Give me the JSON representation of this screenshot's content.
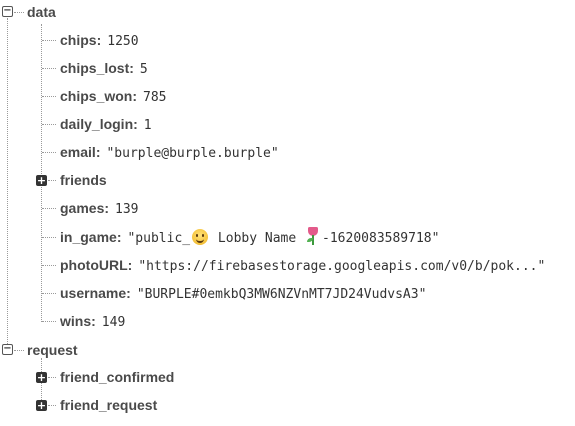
{
  "tree": {
    "data": {
      "label": "data",
      "children": {
        "chips": {
          "key": "chips",
          "value": "1250"
        },
        "chips_lost": {
          "key": "chips_lost",
          "value": "5"
        },
        "chips_won": {
          "key": "chips_won",
          "value": "785"
        },
        "daily_login": {
          "key": "daily_login",
          "value": "1"
        },
        "email": {
          "key": "email",
          "value": "\"burple@burple.burple\""
        },
        "friends": {
          "key": "friends",
          "expandable": true,
          "state": "collapsed"
        },
        "games": {
          "key": "games",
          "value": "139"
        },
        "in_game": {
          "key": "in_game",
          "value_prefix": "\"public_",
          "value_middle": " Lobby Name ",
          "value_suffix": "-1620083589718\"",
          "icons": [
            "smiling-face-emoji",
            "tulip-emoji"
          ]
        },
        "photoURL": {
          "key": "photoURL",
          "value": "\"https://firebasestorage.googleapis.com/v0/b/pok...\""
        },
        "username": {
          "key": "username",
          "value": "\"BURPLE#0emkbQ3MW6NZVnMT7JD24VudvsA3\""
        },
        "wins": {
          "key": "wins",
          "value": "149"
        }
      }
    },
    "request": {
      "label": "request",
      "children": {
        "friend_confirmed": {
          "key": "friend_confirmed",
          "expandable": true,
          "state": "collapsed"
        },
        "friend_request": {
          "key": "friend_request",
          "expandable": true,
          "state": "collapsed"
        }
      }
    }
  },
  "symbols": {
    "expanded": "−",
    "collapsed": "+",
    "colon": ":"
  }
}
